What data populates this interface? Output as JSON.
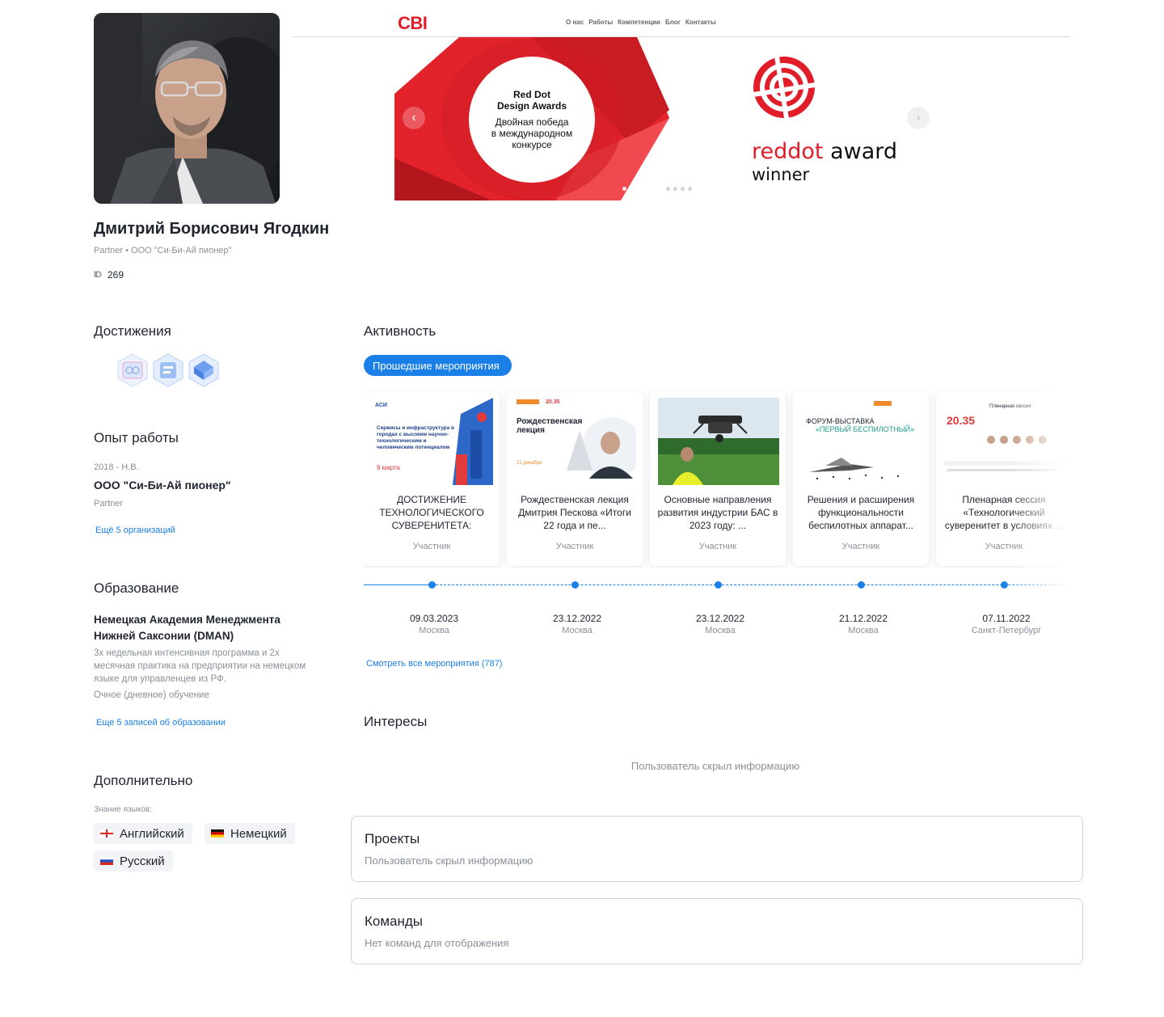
{
  "profile": {
    "name": "Дмитрий Борисович Ягодкин",
    "subtitle": "Partner • ООО \"Си-Би-Ай пионер\"",
    "id_label": "ID",
    "id_value": "269"
  },
  "cover": {
    "logo": "CBI",
    "nav": [
      "О нас",
      "Работы",
      "Компетенции",
      "Блог",
      "Контакты"
    ],
    "slide_title_line1": "Red Dot",
    "slide_title_line2": "Design Awards",
    "slide_text_line1": "Двойная победа",
    "slide_text_line2": "в международном",
    "slide_text_line3": "конкурсе",
    "award_red": "reddot",
    "award_rest": " award",
    "award_winner": "winner",
    "slide_count": 10,
    "active_slide": 6
  },
  "achievements": {
    "title": "Достижения",
    "badges": [
      "achievement-badge-1",
      "achievement-badge-2",
      "achievement-badge-3"
    ]
  },
  "experience": {
    "title": "Опыт работы",
    "period": "2018 - Н.В.",
    "company": "ООО \"Си-Би-Ай пионер\"",
    "position": "Partner",
    "more_link": "Ещё 5 организаций"
  },
  "education": {
    "title": "Образование",
    "institution": "Немецкая Академия Менеджмента Нижней Саксонии (DMAN)",
    "description": "3х недельная интенсивная программа и 2х месячная практика на предприятии на немецком языке для управленцев из РФ.",
    "form": "Очное (дневное) обучение",
    "more_link": "Еще 5 записей об образовании"
  },
  "additional": {
    "title": "Дополнительно",
    "languages_label": "Знание языков:",
    "languages": [
      "Английский",
      "Немецкий",
      "Русский"
    ]
  },
  "activity": {
    "title": "Активность",
    "tab": "Прошедшие мероприятия",
    "events": [
      {
        "title": "ДОСТИЖЕНИЕ ТЕХНОЛОГИЧЕСКОГО СУВЕРЕНИТЕТА:",
        "role": "Участник",
        "date": "09.03.2023",
        "city": "Москва"
      },
      {
        "title": "Рождественская лекция Дмитрия Пескова «Итоги 22 года и пе...",
        "role": "Участник",
        "date": "23.12.2022",
        "city": "Москва"
      },
      {
        "title": "Основные направления развития индустрии БАС в 2023 году: ...",
        "role": "Участник",
        "date": "23.12.2022",
        "city": "Москва"
      },
      {
        "title": "Решения и расширения функциональности беспилотных аппарат...",
        "role": "Участник",
        "date": "21.12.2022",
        "city": "Москва"
      },
      {
        "title": "Пленарная сессия «Технологический суверенитет в условиях ...",
        "role": "Участник",
        "date": "07.11.2022",
        "city": "Санкт-Петербург"
      }
    ],
    "poster1": {
      "org": "АСИ",
      "headline": "Сервисы и инфраструктура в городах с высоким научно-технологическим и человеческим потенциалом",
      "date": "9 марта"
    },
    "poster2": {
      "brand": "20.35",
      "headline": "Рождественская лекция",
      "date": "21 декабря"
    },
    "poster4": {
      "headline": "ФОРУМ-ВЫСТАВКА",
      "sub": "«ПЕРВЫЙ БЕСПИЛОТНЫЙ»"
    },
    "poster5": {
      "brand": "20.35",
      "headline": "Пленарная сессия"
    },
    "all_link": "Смотреть все мероприятия (787)"
  },
  "interests": {
    "title": "Интересы",
    "text": "Пользователь скрыл информацию"
  },
  "projects": {
    "title": "Проекты",
    "text": "Пользователь скрыл информацию"
  },
  "teams": {
    "title": "Команды",
    "text": "Нет команд для отображения"
  },
  "colors": {
    "accent": "#1b7fe8",
    "brand_red": "#e11d2a",
    "text": "#1f2430",
    "muted": "#8a8f99"
  }
}
